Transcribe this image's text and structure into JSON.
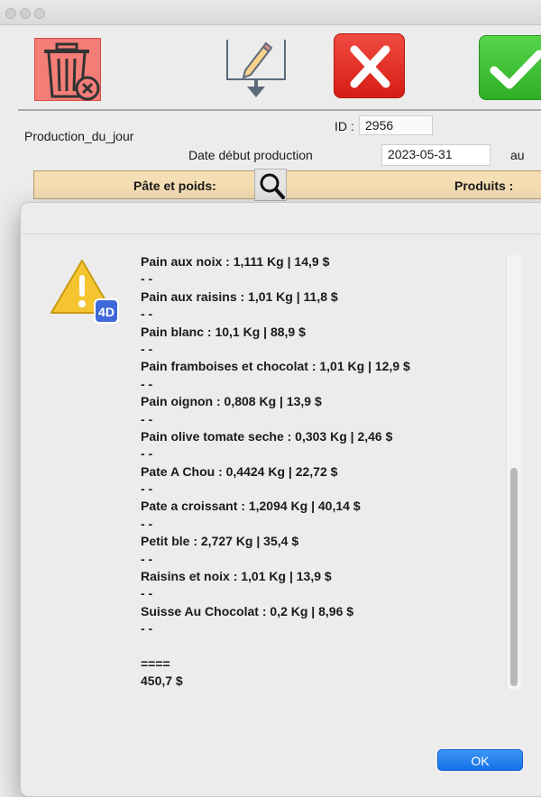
{
  "form": {
    "title": "Production_du_jour",
    "id_label": "ID :",
    "id_value": "2956",
    "date_label": "Date début production",
    "date_value": "2023-05-31",
    "au_label": "au",
    "header_left": "Pâte et poids:",
    "header_right": "Produits :"
  },
  "icons": {
    "trash": "trash-icon",
    "export": "export-pencil-icon",
    "cancel": "cancel-x-icon",
    "validate": "checkmark-icon",
    "search": "search-icon",
    "alert": "warning-icon"
  },
  "colors": {
    "trash_bg": "#f47d78",
    "cancel_red": "#e02e25",
    "validate_green": "#43c439",
    "header_tan": "#f5deb3",
    "ok_blue": "#1d7ff0"
  },
  "alert": {
    "lines": [
      "Pain aux noix : 1,111 Kg | 14,9 $",
      "- -",
      "Pain aux raisins : 1,01 Kg | 11,8 $",
      "- -",
      "Pain blanc : 10,1 Kg | 88,9 $",
      "- -",
      "Pain framboises et chocolat : 1,01 Kg | 12,9 $",
      "- -",
      "Pain oignon : 0,808 Kg | 13,9 $",
      "- -",
      "Pain olive tomate seche : 0,303 Kg | 2,46 $",
      "- -",
      "Pate A Chou : 0,4424 Kg | 22,72 $",
      "- -",
      "Pate a croissant : 1,2094 Kg | 40,14 $",
      "- -",
      "Petit ble : 2,727 Kg | 35,4 $",
      "- -",
      "Raisins et noix : 1,01 Kg | 13,9 $",
      "- -",
      "Suisse Au Chocolat : 0,2 Kg | 8,96 $",
      "- -",
      "",
      "====",
      "450,7 $"
    ],
    "ok_label": "OK",
    "badge_text": "4D"
  }
}
